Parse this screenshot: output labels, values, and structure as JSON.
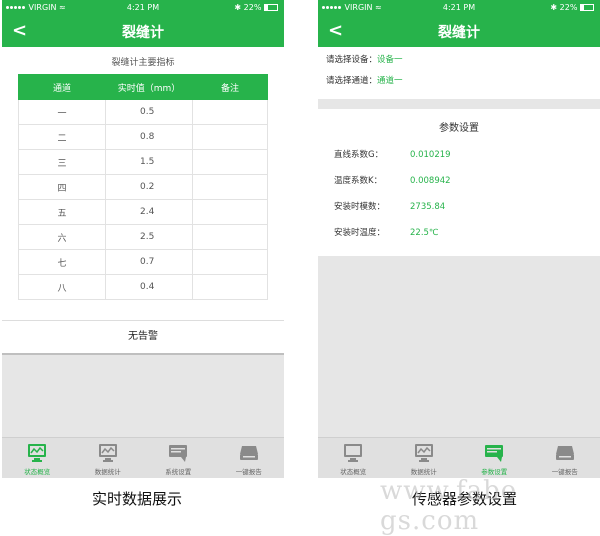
{
  "left_phone": {
    "status": {
      "carrier": "VIRGIN",
      "time": "4:21 PM",
      "battery": "22%"
    },
    "nav": {
      "back": "<",
      "title": "裂缝计"
    },
    "table_title": "裂缝计主要指标",
    "table": {
      "headers": [
        "通道",
        "实时值（mm）",
        "备注"
      ],
      "rows": [
        {
          "channel": "一",
          "value": "0.5",
          "note": ""
        },
        {
          "channel": "二",
          "value": "0.8",
          "note": ""
        },
        {
          "channel": "三",
          "value": "1.5",
          "note": ""
        },
        {
          "channel": "四",
          "value": "0.2",
          "note": ""
        },
        {
          "channel": "五",
          "value": "2.4",
          "note": ""
        },
        {
          "channel": "六",
          "value": "2.5",
          "note": ""
        },
        {
          "channel": "七",
          "value": "0.7",
          "note": ""
        },
        {
          "channel": "八",
          "value": "0.4",
          "note": ""
        }
      ]
    },
    "alarm": "无告警",
    "tabs": [
      {
        "label": "状态概览",
        "icon": "monitor-icon",
        "active": true
      },
      {
        "label": "数据统计",
        "icon": "chart-icon",
        "active": false
      },
      {
        "label": "系统设置",
        "icon": "settings-icon",
        "active": false
      },
      {
        "label": "一键报告",
        "icon": "report-icon",
        "active": false
      }
    ]
  },
  "right_phone": {
    "status": {
      "carrier": "VIRGIN",
      "time": "4:21 PM",
      "battery": "22%"
    },
    "nav": {
      "back": "<",
      "title": "裂缝计"
    },
    "select_device_label": "请选择设备：",
    "select_device_value": "设备一",
    "select_channel_label": "请选择通道：",
    "select_channel_value": "通道一",
    "params_title": "参数设置",
    "params": [
      {
        "label": "直线系数G：",
        "value": "0.010219"
      },
      {
        "label": "温度系数K：",
        "value": "0.008942"
      },
      {
        "label": "安装时模数：",
        "value": "2735.84"
      },
      {
        "label": "安装时温度：",
        "value": "22.5℃"
      }
    ],
    "tabs": [
      {
        "label": "状态概览",
        "icon": "monitor-icon",
        "active": false
      },
      {
        "label": "数据统计",
        "icon": "chart-icon",
        "active": false
      },
      {
        "label": "参数设置",
        "icon": "settings-icon",
        "active": true
      },
      {
        "label": "一键报告",
        "icon": "report-icon",
        "active": false
      }
    ]
  },
  "captions": {
    "left": "实时数据展示",
    "right": "传感器参数设置"
  },
  "watermark": "www.fabe gs.com",
  "colors": {
    "accent": "#27b34b"
  }
}
